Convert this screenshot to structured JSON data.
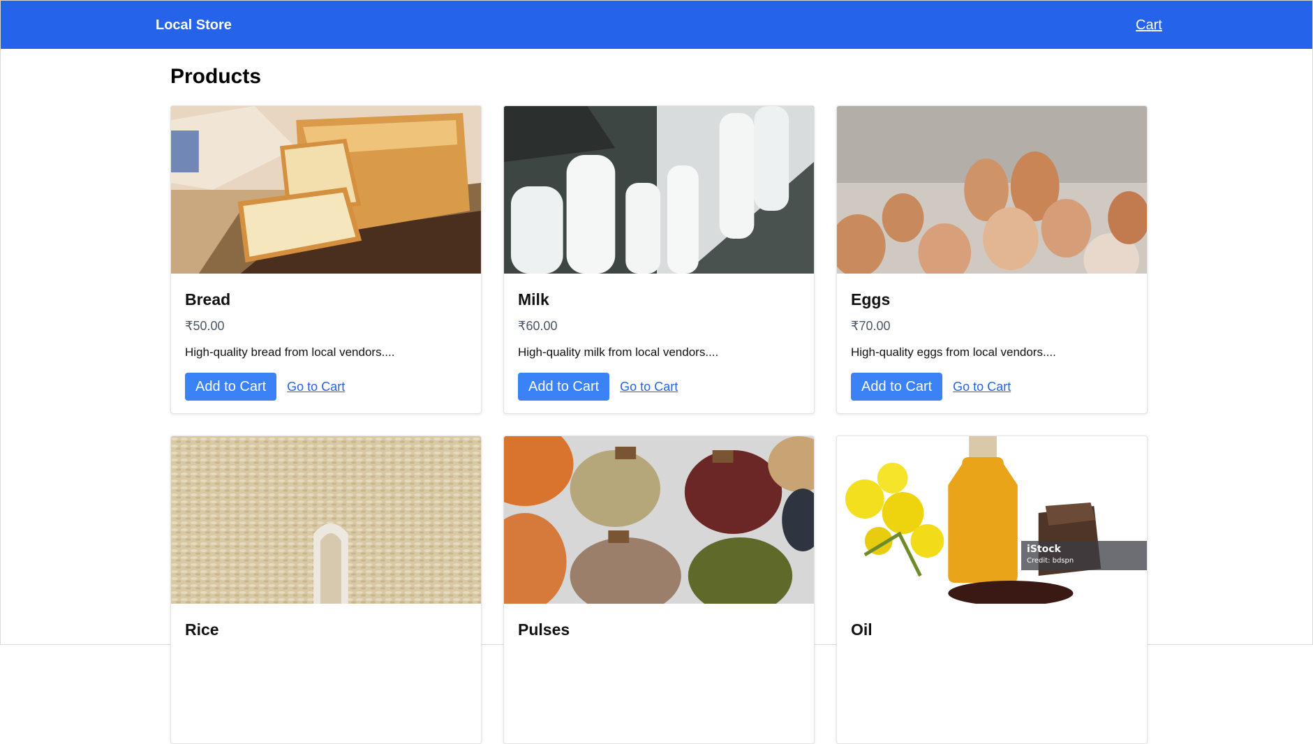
{
  "navbar": {
    "brand": "Local Store",
    "cart_link": "Cart",
    "color": "#2563eb"
  },
  "page": {
    "title": "Products"
  },
  "products": [
    {
      "name": "Bread",
      "price": "₹50.00",
      "description": "High-quality bread from local vendors....",
      "add_label": "Add to Cart",
      "go_label": "Go to Cart",
      "image": "bread-photo"
    },
    {
      "name": "Milk",
      "price": "₹60.00",
      "description": "High-quality milk from local vendors....",
      "add_label": "Add to Cart",
      "go_label": "Go to Cart",
      "image": "milk-bottles-photo"
    },
    {
      "name": "Eggs",
      "price": "₹70.00",
      "description": "High-quality eggs from local vendors....",
      "add_label": "Add to Cart",
      "go_label": "Go to Cart",
      "image": "eggs-photo"
    },
    {
      "name": "Rice",
      "image": "rice-photo"
    },
    {
      "name": "Pulses",
      "image": "pulses-photo"
    },
    {
      "name": "Oil",
      "image": "mustard-oil-photo",
      "watermark": {
        "brand": "iStock",
        "credit": "Credit: bdspn"
      }
    }
  ],
  "colors": {
    "button": "#3b82f6",
    "link": "#2563eb",
    "price": "#4b5563"
  }
}
